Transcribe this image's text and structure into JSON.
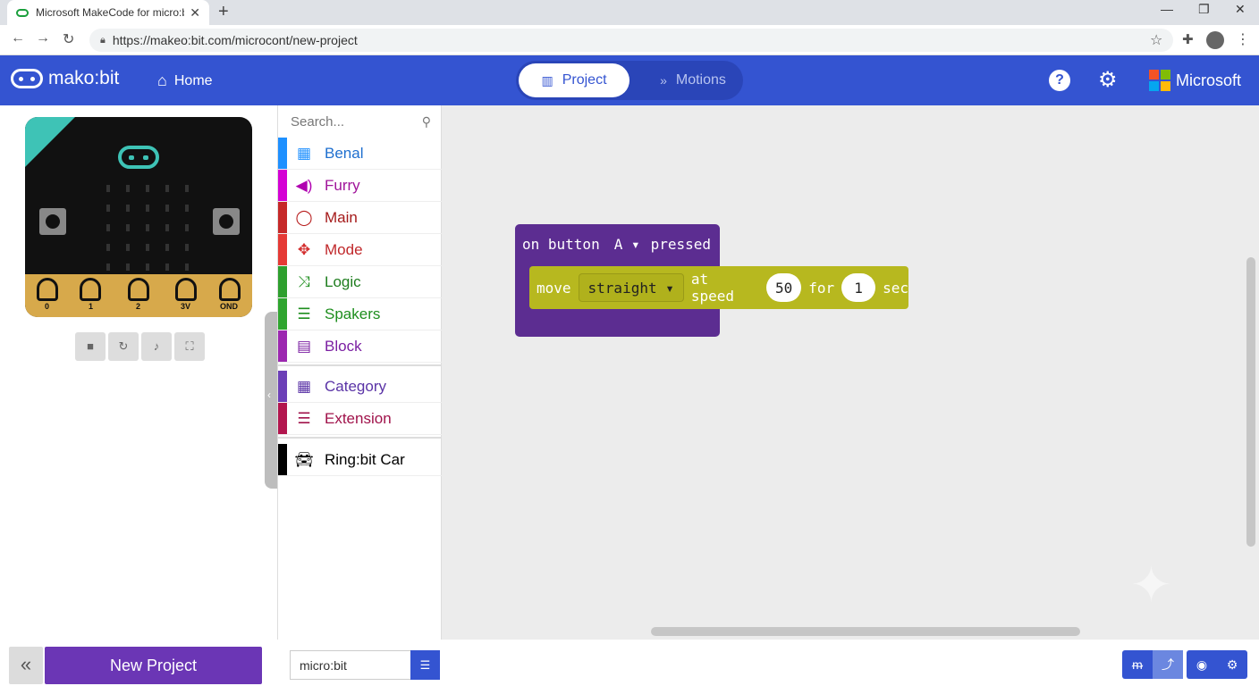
{
  "browser": {
    "tab_title": "Microsoft MakeCode for micro:bi",
    "tab_close": "✕",
    "new_tab": "+",
    "url": "https://makeo:bit.com/microcont/new-project"
  },
  "header": {
    "logo_text": "mako:bit",
    "home_label": "Home",
    "project_tab": "Project",
    "motions_tab": "Motions",
    "help_label": "?",
    "brand": "Microsoft",
    "brand_colors": [
      "#f35325",
      "#81bc06",
      "#05a6f0",
      "#ffba08"
    ]
  },
  "simulator": {
    "pins": [
      "0",
      "1",
      "2",
      "3V",
      "OND"
    ],
    "controls": [
      "stop-icon",
      "restart-icon",
      "audio-icon",
      "fullscreen-icon"
    ]
  },
  "toolbox": {
    "search_placeholder": "Search...",
    "categories": [
      {
        "label": "Benal",
        "color": "#1e90ff",
        "icon": "grid-icon"
      },
      {
        "label": "Furry",
        "color": "#d400d4",
        "icon": "speaker-icon"
      },
      {
        "label": "Main",
        "color": "#c62828",
        "icon": "circle-icon"
      },
      {
        "label": "Mode",
        "color": "#e53935",
        "icon": "puzzle-icon"
      },
      {
        "label": "Logic",
        "color": "#2e9f2e",
        "icon": "shuffle-icon"
      },
      {
        "label": "Spakers",
        "color": "#2fa52f",
        "icon": "list-icon"
      },
      {
        "label": "Block",
        "color": "#9c27b0",
        "icon": "block-icon"
      },
      {
        "label": "Category",
        "color": "#6c3fb7",
        "icon": "grid-icon"
      },
      {
        "label": "Extension",
        "color": "#b2164e",
        "icon": "list-icon"
      },
      {
        "label": "Ring:bit Car",
        "color": "#000000",
        "icon": "car-icon"
      }
    ]
  },
  "workspace": {
    "event_block": {
      "prefix": "on button",
      "button": "A",
      "suffix": "pressed",
      "color": "#5c2d91"
    },
    "move_block": {
      "move": "move",
      "direction": "straight",
      "at_speed": "at speed",
      "speed": "50",
      "for": "for",
      "duration": "1",
      "unit": "sec",
      "color": "#b7b81f"
    }
  },
  "footer": {
    "new_project": "New Project",
    "project_name": "micro:bit"
  }
}
